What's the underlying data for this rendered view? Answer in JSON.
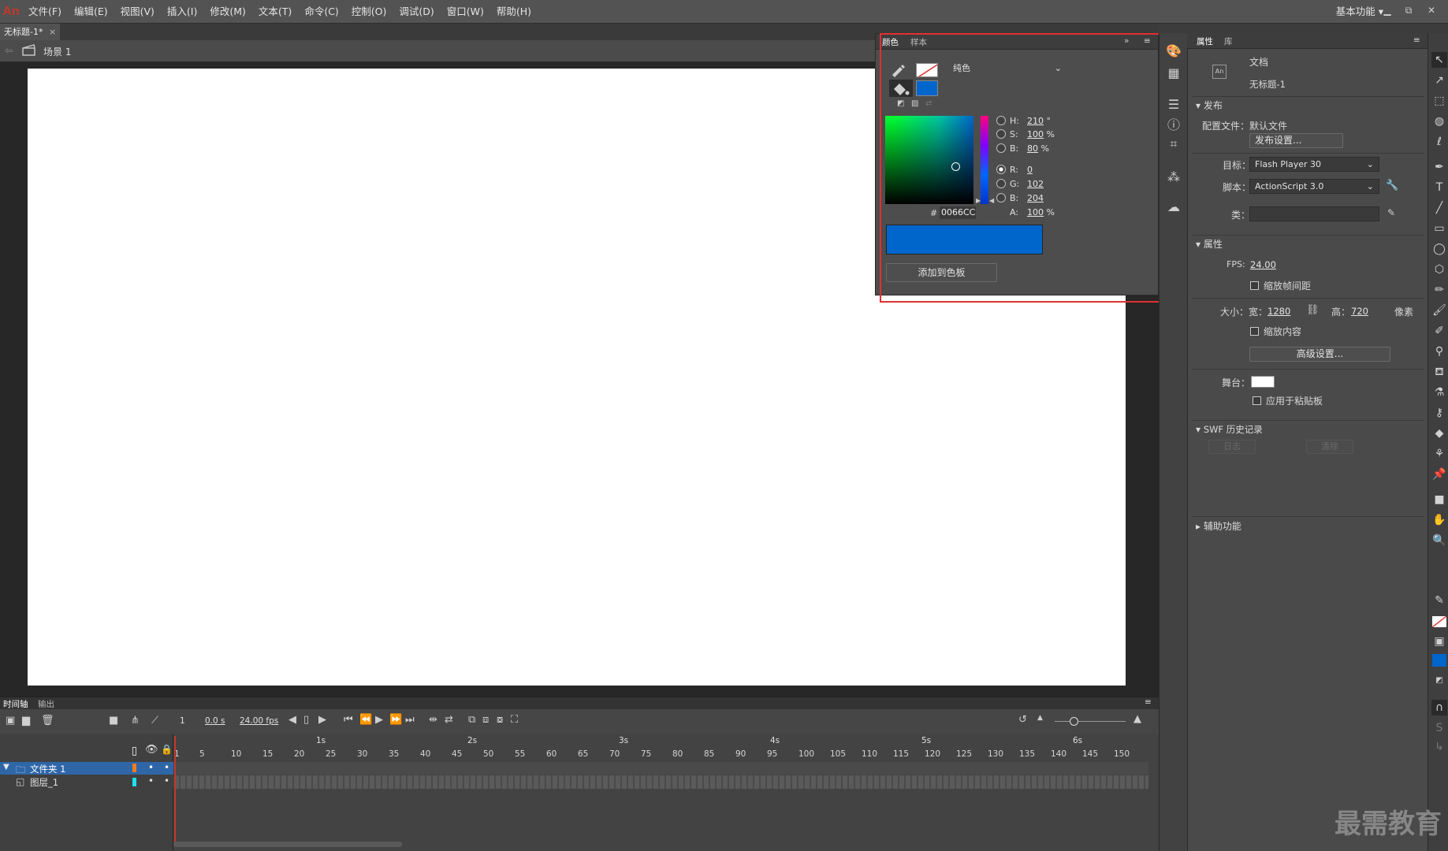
{
  "app": {
    "logo": "An"
  },
  "menu": [
    "文件(F)",
    "编辑(E)",
    "视图(V)",
    "插入(I)",
    "修改(M)",
    "文本(T)",
    "命令(C)",
    "控制(O)",
    "调试(D)",
    "窗口(W)",
    "帮助(H)"
  ],
  "workspace": {
    "label": "基本功能",
    "arrow": "▾"
  },
  "window_controls": {
    "minimize": "▁",
    "restore": "⧉",
    "close": "✕"
  },
  "doc_tab": {
    "title": "无标题-1*",
    "close": "×"
  },
  "scene": {
    "label": "场景 1"
  },
  "color_panel": {
    "tab_color": "颜色",
    "tab_swatches": "样本",
    "fill_type": "纯色",
    "fill_color": "#0066CC",
    "H": "210",
    "H_unit": "°",
    "S": "100",
    "S_unit": "%",
    "B": "80",
    "B_unit": "%",
    "R": "0",
    "G": "102",
    "Bv": "204",
    "A": "100",
    "A_unit": "%",
    "hex_prefix": "#",
    "hex": "0066CC",
    "add_swatch": "添加到色板",
    "labels": {
      "H": "H:",
      "S": "S:",
      "B": "B:",
      "R": "R:",
      "G": "G:",
      "Bv": "B:",
      "A": "A:"
    }
  },
  "properties": {
    "tab_props": "属性",
    "tab_library": "库",
    "doc_type": "文档",
    "doc_name": "无标题-1",
    "publish_section": "发布",
    "profile_label": "配置文件：",
    "profile_value": "默认文件",
    "publish_settings": "发布设置...",
    "target_label": "目标：",
    "target_value": "Flash Player 30",
    "script_label": "脚本：",
    "script_value": "ActionScript 3.0",
    "class_label": "类：",
    "props_section": "属性",
    "fps_label": "FPS:",
    "fps_value": "24.00",
    "scale_spans": "缩放帧间距",
    "size_label": "大小：",
    "width_label": "宽：",
    "width_value": "1280",
    "height_label": "高：",
    "height_value": "720",
    "unit": "像素",
    "scale_content": "缩放内容",
    "advanced": "高级设置...",
    "stage_label": "舞台：",
    "stage_color": "#FFFFFF",
    "apply_paste": "应用于粘贴板",
    "swf_section": "SWF 历史记录",
    "log_btn": "日志",
    "clear_btn": "清除",
    "accessibility": "辅助功能"
  },
  "timeline": {
    "tab_timeline": "时间轴",
    "tab_output": "输出",
    "frame": "1",
    "time": "0.0 s",
    "fps": "24.00 fps",
    "seconds": [
      "1s",
      "2s",
      "3s",
      "4s",
      "5s",
      "6s"
    ],
    "frame_numbers": [
      "1",
      "5",
      "10",
      "15",
      "20",
      "25",
      "30",
      "35",
      "40",
      "45",
      "50",
      "55",
      "60",
      "65",
      "70",
      "75",
      "80",
      "85",
      "90",
      "95",
      "100",
      "105",
      "110",
      "115",
      "120",
      "125",
      "130",
      "135",
      "140",
      "145",
      "150"
    ],
    "layers": [
      {
        "name": "文件夹 1",
        "color": "#f07a1f"
      },
      {
        "name": "图层_1",
        "color": "#1ee0f0"
      }
    ]
  },
  "watermark": "最需教育"
}
